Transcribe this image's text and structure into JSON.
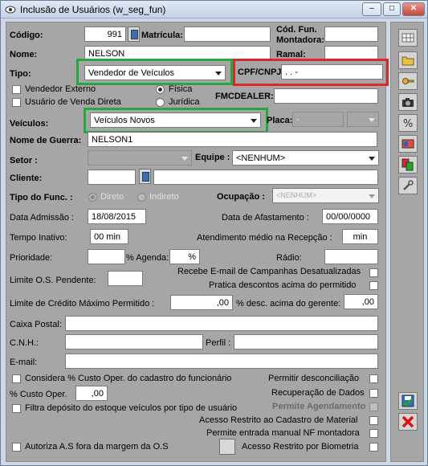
{
  "window": {
    "title": "Inclusão de Usuários (w_seg_fun)",
    "min": "–",
    "max": "□",
    "close": "✕"
  },
  "form": {
    "codigo_label": "Código:",
    "codigo_value": "991",
    "matricula_label": "Matrícula:",
    "matricula_value": "",
    "cod_fun_montadora_label_1": "Cód. Fun.",
    "cod_fun_montadora_label_2": "Montadora:",
    "cod_fun_montadora_value": "",
    "nome_label": "Nome:",
    "nome_value": "NELSON",
    "ramal_label": "Ramal:",
    "ramal_value": "",
    "tipo_label": "Tipo:",
    "tipo_value": "Vendedor de Veículos",
    "cpf_cnpj_label": "CPF/CNPJ:",
    "cpf_cnpj_value": ".   .   -",
    "vendedor_externo_label": "Vendedor Externo",
    "usuario_venda_direta_label": "Usuário de Venda Direta",
    "fisica_label": "Física",
    "juridica_label": "Jurídica",
    "fmcdealer_label": "FMCDEALER:",
    "fmcdealer_value": "",
    "veiculos_label": "Veículos:",
    "veiculos_value": "Veículos Novos",
    "placa_label": "Placa:",
    "placa_value_1": "-",
    "placa_value_2": "",
    "nome_guerra_label": "Nome de Guerra:",
    "nome_guerra_value": "NELSON1",
    "setor_label": "Setor :",
    "setor_value": "",
    "equipe_label": "Equipe :",
    "equipe_value": "<NENHUM>",
    "cliente_label": "Cliente:",
    "cliente_code": "",
    "cliente_name": "",
    "tipo_func_label": "Tipo do Func. :",
    "direto_label": "Direto",
    "indireto_label": "Indireto",
    "ocupacao_label": "Ocupação :",
    "ocupacao_value": "<NENHUM>",
    "data_admissao_label": "Data Admissão :",
    "data_admissao_value": "18/08/2015",
    "data_afastamento_label": "Data de Afastamento :",
    "data_afastamento_value": "00/00/0000",
    "tempo_inativo_label": "Tempo Inativo:",
    "tempo_inativo_value": "00 min",
    "atendimento_label": "Atendimento médio na Recepção :",
    "atendimento_value": "min",
    "prioridade_label": "Prioridade:",
    "prioridade_value": "",
    "agenda_label": "% Agenda:",
    "agenda_value": "%",
    "radio_label": "Rádio:",
    "radio_value": "",
    "limite_os_label": "Limite O.S. Pendente:",
    "limite_os_value": "",
    "recebe_email_label": "Recebe E-mail de Campanhas Desatualizadas",
    "pratica_descontos_label": "Pratica descontos acima do permitido",
    "limite_credito_label": "Limite de Crédito Máximo Permitido :",
    "limite_credito_value": ",00",
    "desc_gerente_label": "% desc. acima do gerente:",
    "desc_gerente_value": ",00",
    "caixa_postal_label": "Caixa Postal:",
    "caixa_postal_value": "",
    "cnh_label": "C.N.H.:",
    "cnh_value": "",
    "perfil_label": "Perfil :",
    "perfil_value": "",
    "email_label": "E-mail:",
    "email_value": "",
    "considera_custo_label": "Considera % Custo Oper. do cadastro do funcionário",
    "permitir_desconciliacao_label": "Permitir desconciliação",
    "custo_oper_label": "% Custo Oper.",
    "custo_oper_value": ",00",
    "recuperacao_dados_label": "Recuperação de Dados",
    "permite_agendamento_label": "Permite Agendamento",
    "filtra_deposito_label": "Filtra depósito do estoque veículos por tipo de usuário",
    "acesso_restrito_material_label": "Acesso Restrito ao Cadastro de Material",
    "permite_nf_manual_label": "Permite entrada manual NF montadora",
    "autoriza_as_label": "Autoriza A.S fora da margem da O.S",
    "acesso_biometria_label": "Acesso Restrito por Biometria"
  },
  "toolbar": [
    "grid-icon",
    "open-folder-icon",
    "key-icon",
    "camera-icon",
    "percent-icon",
    "card-icon",
    "color-pages-icon",
    "wrench-icon",
    "save-icon",
    "cancel-icon"
  ],
  "colors": {
    "panel": "#a6a6a6",
    "highlight_green": "#22aa3a",
    "highlight_red": "#d82a2a"
  }
}
